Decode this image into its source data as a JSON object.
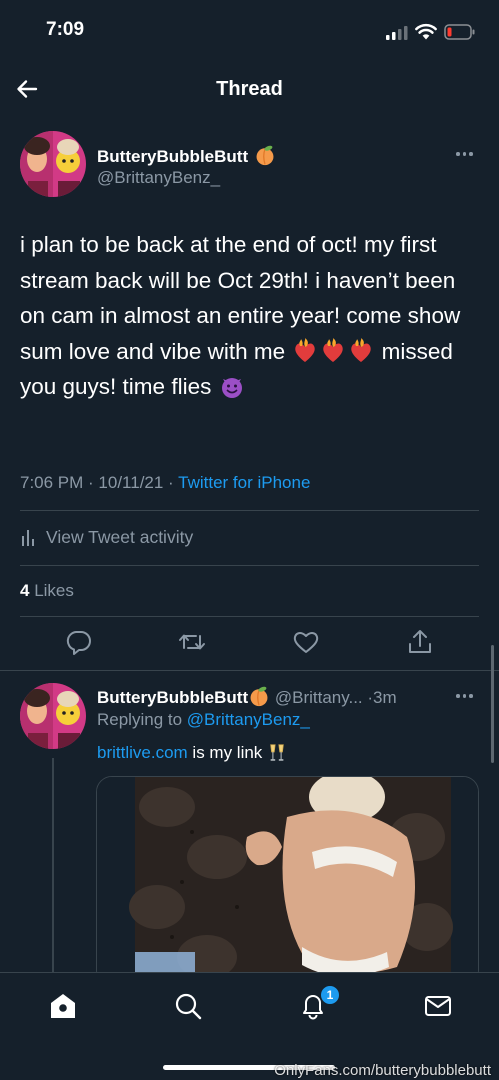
{
  "status_bar": {
    "time": "7:09"
  },
  "header": {
    "title": "Thread"
  },
  "tweet": {
    "author_name": "ButteryBubbleButt",
    "author_emoji": "peach-emoji",
    "author_handle": "@BrittanyBenz_",
    "text_part1": "i plan to be back at the end of oct! my first stream back will be Oct 29th! i haven’t been on cam in almost an entire year! come show sum love and vibe with me",
    "text_emojis": [
      "heart-on-fire-emoji",
      "heart-on-fire-emoji",
      "heart-on-fire-emoji"
    ],
    "text_part2": "missed you guys! time flies",
    "text_end_emoji": "smiling-devil-emoji",
    "time": "7:06 PM · 10/11/21 ·",
    "source": "Twitter for iPhone",
    "activity_label": "View Tweet activity",
    "likes_count": "4",
    "likes_label": "Likes"
  },
  "reply": {
    "author_name": "ButteryBubbleButt",
    "author_handle": "@Brittany...",
    "time": "·3m",
    "replying_to_label": "Replying to",
    "replying_to_handle": "@BrittanyBenz_",
    "link": "brittlive.com",
    "text_rest": " is my link",
    "text_emoji": "clinking-glasses-emoji"
  },
  "tab_bar": {
    "tabs": [
      "home",
      "search",
      "notifications",
      "messages"
    ],
    "notification_badge": "1"
  },
  "watermark": "OnlyFans.com/butterybubblebutt",
  "colors": {
    "background": "#15202b",
    "accent": "#1d9bf0",
    "secondary_text": "#8b98a5",
    "divider": "#38444d"
  }
}
